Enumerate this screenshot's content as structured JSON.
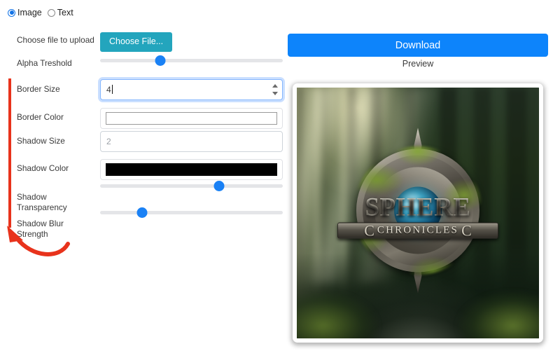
{
  "mode_selector": {
    "options": [
      {
        "label": "Image",
        "selected": true
      },
      {
        "label": "Text",
        "selected": false
      }
    ]
  },
  "form": {
    "rows": [
      {
        "label": "Choose file to upload",
        "control": "file-button",
        "value": "Choose File..."
      },
      {
        "label": "Alpha Treshold",
        "control": "slider",
        "value": 33
      },
      {
        "label": "Border Size",
        "control": "number",
        "value": "4"
      },
      {
        "label": "Border Color",
        "control": "color",
        "value": "#ffffff"
      },
      {
        "label": "Shadow Size",
        "control": "text",
        "value": "2"
      },
      {
        "label": "Shadow Color",
        "control": "color",
        "value": "#000000"
      },
      {
        "label": "Shadow Transparency",
        "control": "slider",
        "value": 65
      },
      {
        "label": "Shadow Blur Strength",
        "control": "slider",
        "value": 23
      }
    ],
    "choose_file_label": "Choose File...",
    "border_size_value": "4",
    "shadow_size_value": "2",
    "border_color_value": "#ffffff",
    "shadow_color_value": "#000000",
    "alpha_threshold_percent": 33,
    "shadow_transparency_percent": 65,
    "shadow_blur_percent": 23,
    "labels": {
      "choose_file": "Choose file to upload",
      "alpha_threshold": "Alpha Treshold",
      "border_size": "Border Size",
      "border_color": "Border Color",
      "shadow_size": "Shadow Size",
      "shadow_color": "Shadow Color",
      "shadow_transparency": "Shadow Transparency",
      "shadow_blur": "Shadow Blur Strength"
    }
  },
  "right_panel": {
    "download_label": "Download",
    "preview_caption": "Preview",
    "preview_image": {
      "title": "SPHERE",
      "subtitle": "CHRONICLES",
      "flourish_left": "C",
      "flourish_right": "C",
      "scene": "misty forest path with glowing sun rays and mossy stones"
    }
  },
  "annotation": {
    "type": "red-bracket-and-curved-arrow",
    "color": "#e8331c",
    "points_to": "Shadow settings label column"
  },
  "colors": {
    "accent_teal": "#23a5bd",
    "accent_blue": "#0d84fb",
    "slider_thumb": "#1a81f5",
    "annotation_red": "#e8331c",
    "page_background": "#ffffff"
  }
}
